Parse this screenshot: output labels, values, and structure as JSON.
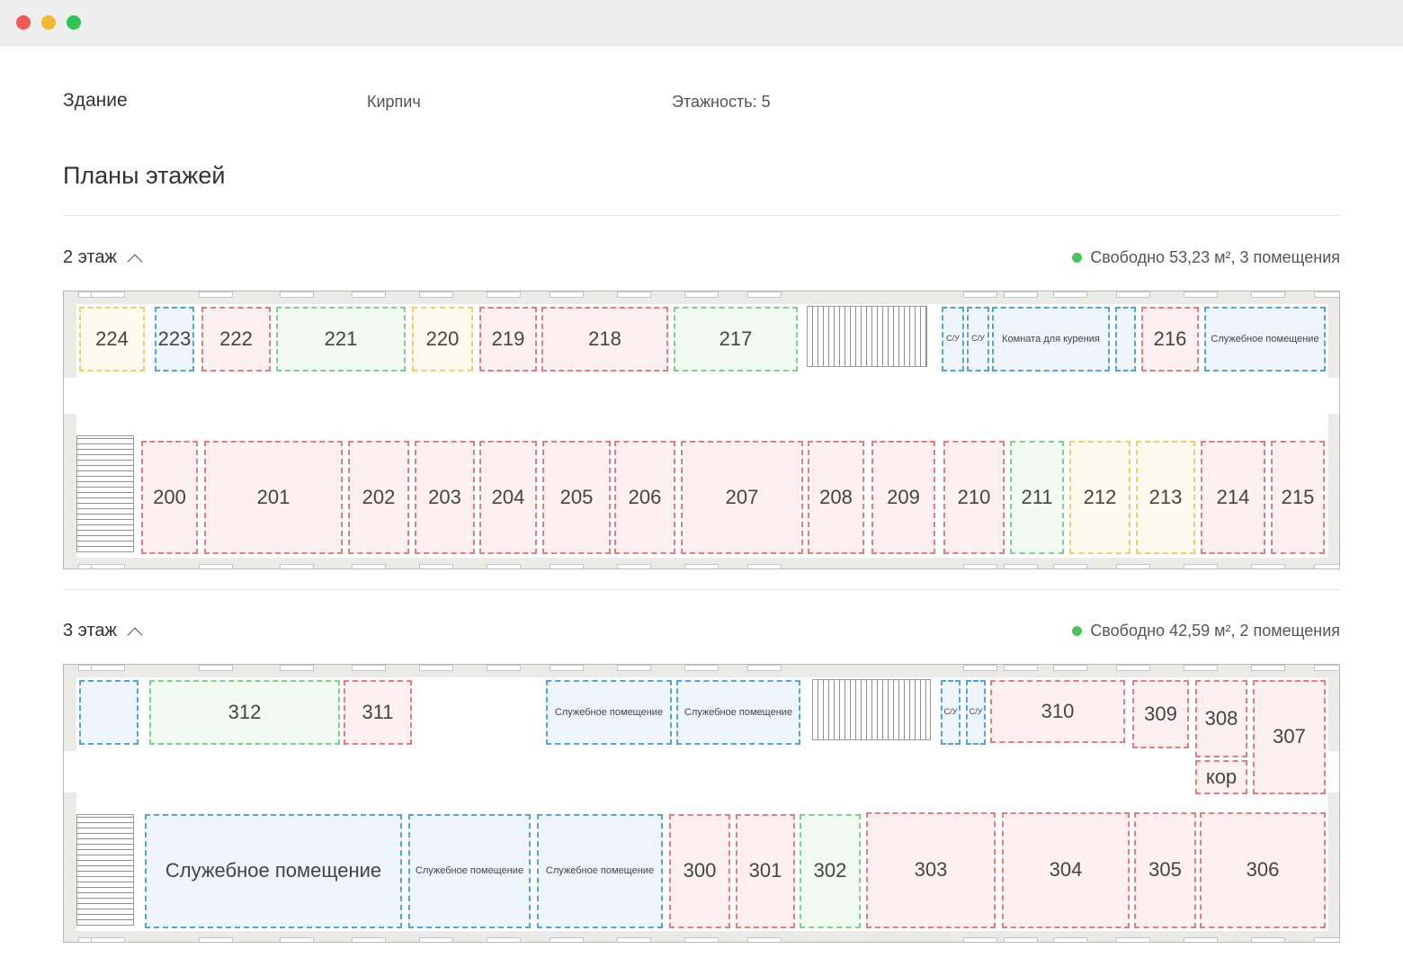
{
  "window": {
    "controls": [
      "close",
      "minimize",
      "maximize"
    ],
    "colors": {
      "close": "#f05a54",
      "minimize": "#f5b731",
      "maximize": "#2fc553"
    }
  },
  "building": {
    "label": "Здание",
    "material": "Кирпич",
    "floors": "Этажность: 5"
  },
  "section_title": "Планы этажей",
  "status_color": "#4cc35a",
  "room_colors": {
    "red": "#e87b7b",
    "green": "#7fd18a",
    "yellow": "#f1cd6c",
    "blue": "#51a4e3"
  },
  "floor2": {
    "title": "2 этаж",
    "status": "Свободно 53,23 м², 3 помещения",
    "rooms": {
      "r224": "224",
      "r223": "223",
      "r222": "222",
      "r221": "221",
      "r220": "220",
      "r219": "219",
      "r218": "218",
      "r217": "217",
      "wc1": "С/У",
      "wc2": "С/У",
      "smoking": "Комната для курения",
      "r216": "216",
      "service": "Служебное помещение",
      "r200": "200",
      "r201": "201",
      "r202": "202",
      "r203": "203",
      "r204": "204",
      "r205": "205",
      "r206": "206",
      "r207": "207",
      "r208": "208",
      "r209": "209",
      "r210": "210",
      "r211": "211",
      "r212": "212",
      "r213": "213",
      "r214": "214",
      "r215": "215"
    }
  },
  "floor3": {
    "title": "3 этаж",
    "status": "Свободно 42,59 м², 2 помещения",
    "rooms": {
      "r312": "312",
      "r311": "311",
      "service1": "Служебное помещение",
      "service2": "Служебное помещение",
      "wc1": "С/У",
      "wc2": "С/У",
      "r310": "310",
      "r309": "309",
      "r308": "308",
      "r307": "307",
      "kor": "кор",
      "service_big": "Служебное помещение",
      "service3": "Служебное помещение",
      "service4": "Служебное помещение",
      "r300": "300",
      "r301": "301",
      "r302": "302",
      "r303": "303",
      "r304": "304",
      "r305": "305",
      "r306": "306"
    }
  }
}
